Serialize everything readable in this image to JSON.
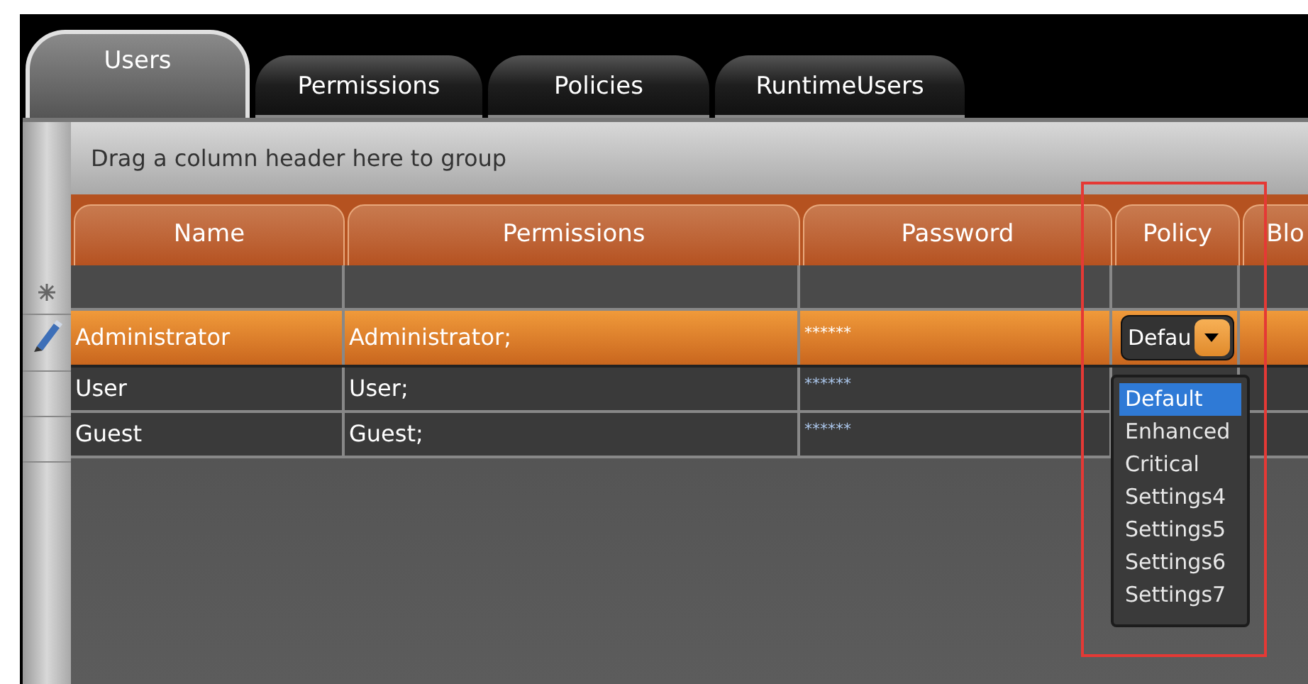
{
  "tabs": [
    {
      "label": "Users",
      "selected": true
    },
    {
      "label": "Permissions",
      "selected": false
    },
    {
      "label": "Policies",
      "selected": false
    },
    {
      "label": "RuntimeUsers",
      "selected": false
    }
  ],
  "group_panel": {
    "text": "Drag a column header here to group"
  },
  "table": {
    "columns": [
      "Name",
      "Permissions",
      "Password",
      "Policy",
      "Blo"
    ],
    "rows": [
      {
        "name": "Administrator",
        "permissions": "Administrator;",
        "password": "******",
        "policy": "Defau",
        "selected": true,
        "editing": true
      },
      {
        "name": "User",
        "permissions": "User;",
        "password": "******",
        "selected": false,
        "editing": false
      },
      {
        "name": "Guest",
        "permissions": "Guest;",
        "password": "******",
        "selected": false,
        "editing": false
      }
    ]
  },
  "policy_dropdown": {
    "options": [
      {
        "label": "Default",
        "selected": true
      },
      {
        "label": "Enhanced",
        "selected": false
      },
      {
        "label": "Critical",
        "selected": false
      },
      {
        "label": "Settings4",
        "selected": false
      },
      {
        "label": "Settings5",
        "selected": false
      },
      {
        "label": "Settings6",
        "selected": false
      },
      {
        "label": "Settings7",
        "selected": false
      }
    ]
  }
}
